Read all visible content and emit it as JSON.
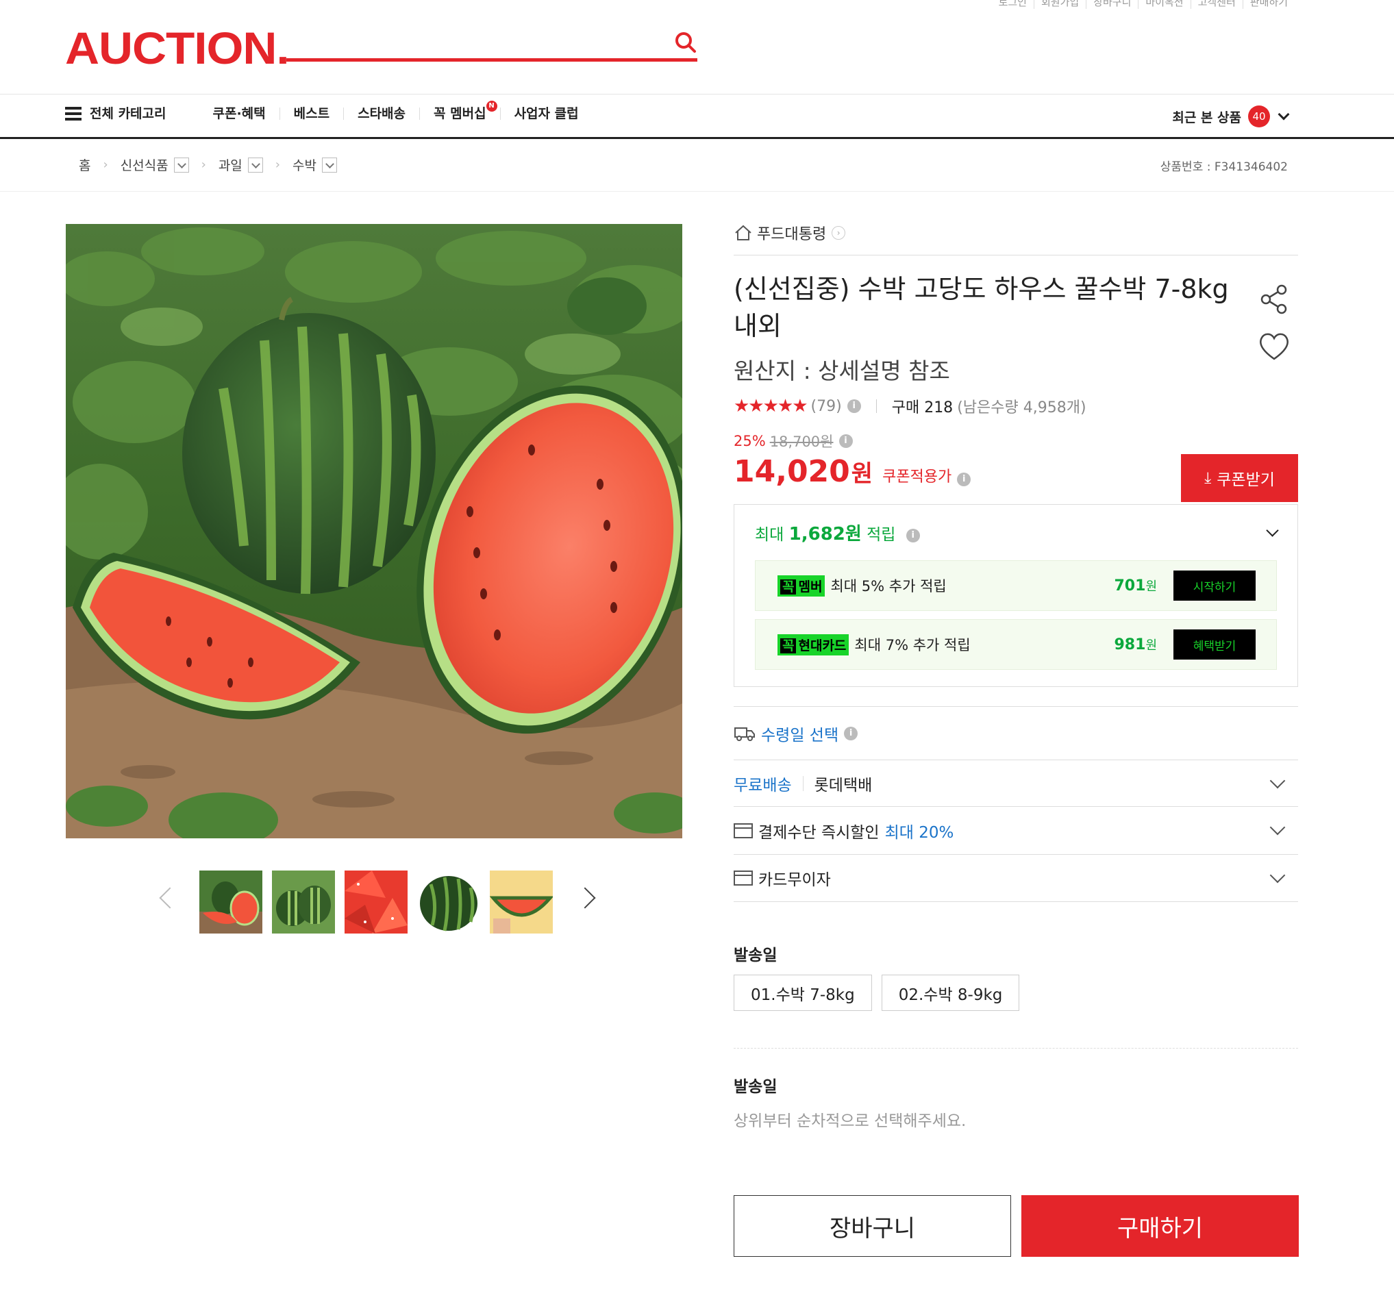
{
  "utility_links": [
    "로그인",
    "회원가입",
    "장바구니",
    "마이옥션",
    "고객센터",
    "판매하기"
  ],
  "header": {
    "logo": "AUCTION.",
    "search_placeholder": ""
  },
  "gnb": {
    "all_categories": "전체 카테고리",
    "items": [
      "쿠폰·혜택",
      "베스트",
      "스타배송",
      "꼭 멤버십",
      "사업자 클럽"
    ],
    "membership_badge": "N",
    "recent_label": "최근 본 상품",
    "recent_count": "40"
  },
  "breadcrumb": {
    "home": "홈",
    "levels": [
      "신선식품",
      "과일",
      "수박"
    ],
    "product_number": "상품번호 : F341346402"
  },
  "product": {
    "seller": "푸드대통령",
    "title": "(신선집중) 수박 고당도 하우스 꿀수박 7-8kg 내외",
    "origin": "원산지 : 상세설명 참조",
    "stars": "★★★★★",
    "rating_value": 4.5,
    "review_count": "(79)",
    "purchase_label": "구매 218",
    "remaining": "(남은수량 4,958개)",
    "discount_rate": "25%",
    "original_price": "18,700원",
    "price": "14,020",
    "price_unit": "원",
    "price_label": "쿠폰적용가",
    "coupon_button": "쿠폰받기"
  },
  "points": {
    "prefix": "최대",
    "amount": "1,682원",
    "suffix": "적립",
    "rows": [
      {
        "badge_k": "꼭",
        "badge": "멤버",
        "text": "최대 5% 추가 적립",
        "amount": "701",
        "unit": "원",
        "button": "시작하기"
      },
      {
        "badge_k": "꼭",
        "badge": "현대카드",
        "text": "최대 7% 추가 적립",
        "amount": "981",
        "unit": "원",
        "button": "혜택받기"
      }
    ]
  },
  "shipping": {
    "select_date": "수령일 선택",
    "free_shipping": "무료배송",
    "courier": "롯데택배",
    "payment_discount": "결제수단 즉시할인",
    "payment_discount_max": "최대 20%",
    "installment": "카드무이자"
  },
  "options": {
    "label": "발송일",
    "choices": [
      "01.수박 7-8kg",
      "02.수박 8-9kg"
    ],
    "label2": "발송일",
    "hint": "상위부터 순차적으로 선택해주세요."
  },
  "actions": {
    "cart": "장바구니",
    "buy": "구매하기"
  },
  "colors": {
    "brand_red": "#e4252a",
    "points_green": "#0ba83c",
    "link_blue": "#1a73c9"
  }
}
